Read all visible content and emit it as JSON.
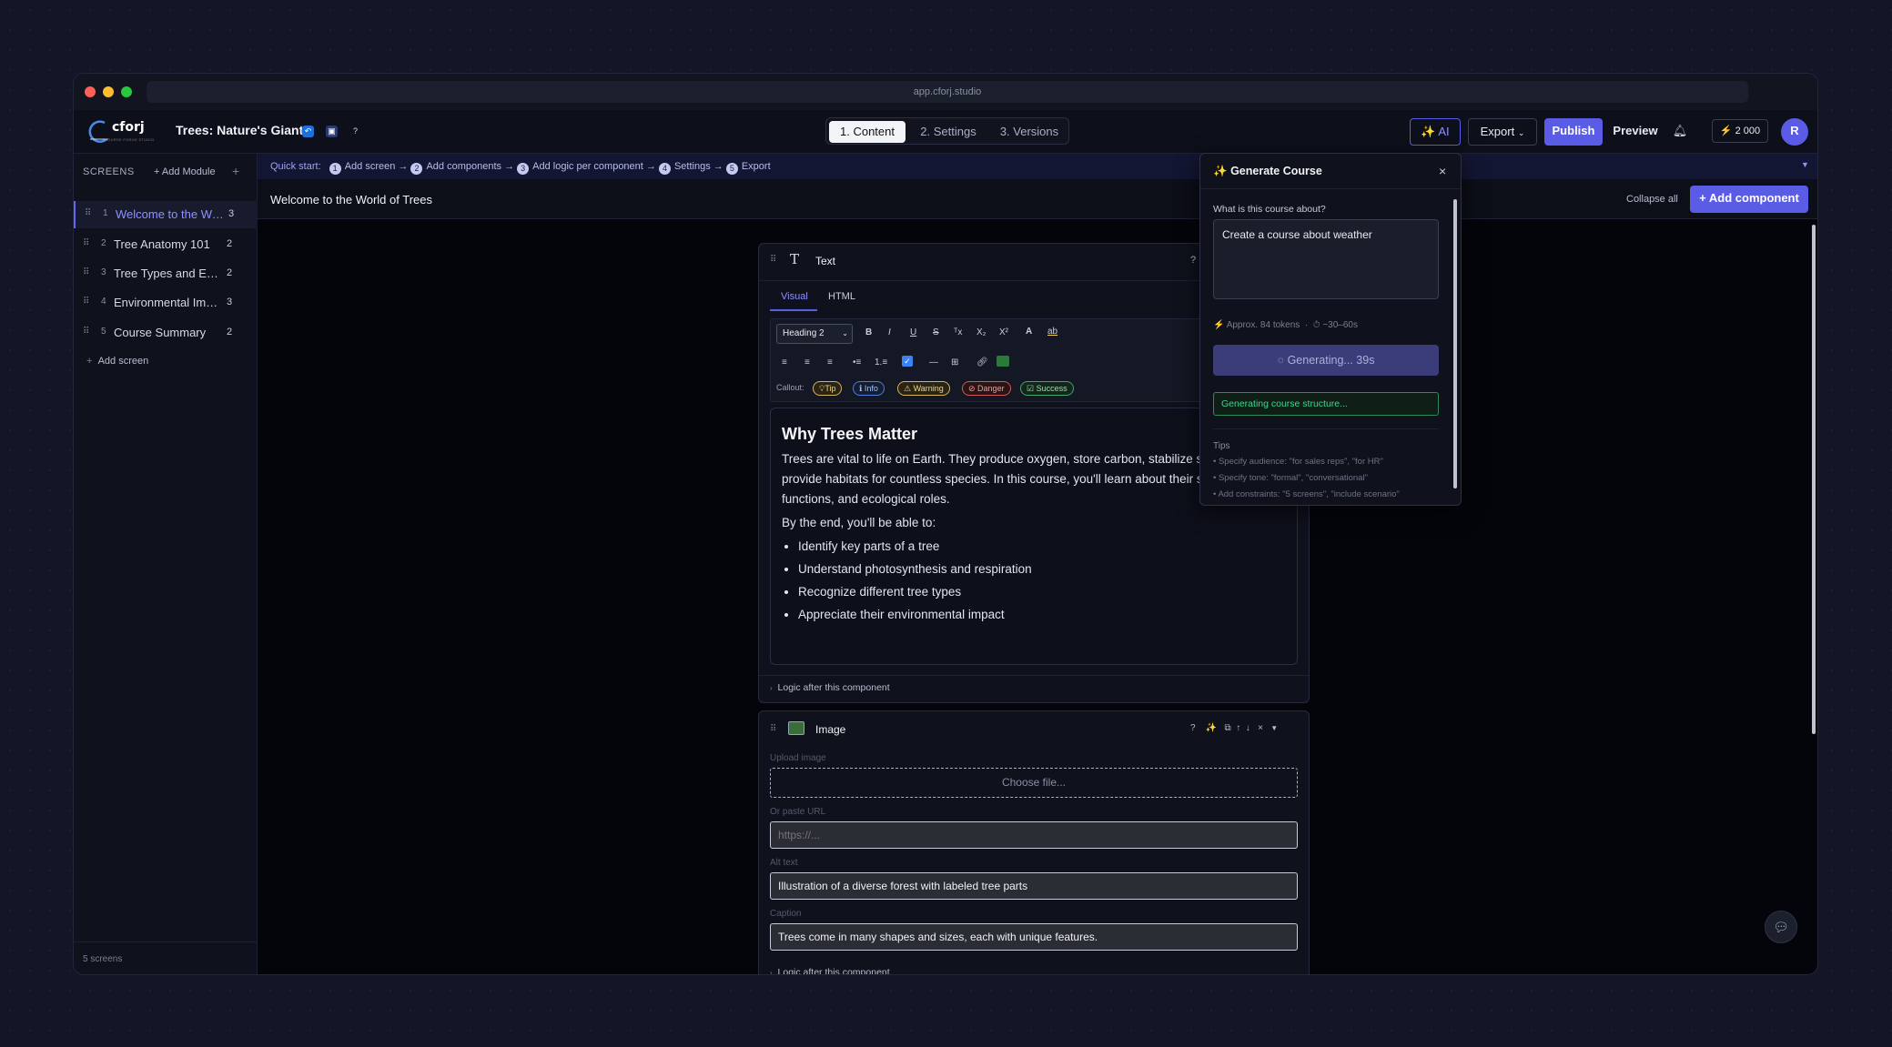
{
  "browser": {
    "url": "app.cforj.studio"
  },
  "app": {
    "logo_word": "cforj",
    "logo_tagline": "COURSE FORGE STUDIO",
    "project_title": "Trees: Nature's Giants",
    "help": "?"
  },
  "tabs": [
    {
      "label": "1. Content"
    },
    {
      "label": "2. Settings"
    },
    {
      "label": "3. Versions"
    }
  ],
  "header": {
    "ai_label": "AI",
    "export_label": "Export",
    "publish_label": "Publish",
    "preview_label": "Preview",
    "credits": "2 000",
    "avatar": "R"
  },
  "sidebar": {
    "heading": "SCREENS",
    "add_module": "+ Add Module",
    "add_icon": "+",
    "add_screen": "Add screen",
    "footer": "5 screens",
    "items": [
      {
        "num": "1",
        "label": "Welcome to the World of Trees",
        "count": "3"
      },
      {
        "num": "2",
        "label": "Tree Anatomy 101",
        "count": "2"
      },
      {
        "num": "3",
        "label": "Tree Types and Ecology",
        "count": "2"
      },
      {
        "num": "4",
        "label": "Environmental Impact",
        "count": "3"
      },
      {
        "num": "5",
        "label": "Course Summary",
        "count": "2"
      }
    ]
  },
  "quickstart": {
    "label": "Quick start:",
    "steps": [
      {
        "n": "1",
        "label": "Add screen"
      },
      {
        "n": "2",
        "label": "Add components"
      },
      {
        "n": "3",
        "label": "Add logic per component"
      },
      {
        "n": "4",
        "label": "Settings"
      },
      {
        "n": "5",
        "label": "Export"
      }
    ]
  },
  "screen": {
    "title": "Welcome to the World of Trees",
    "collapse_all": "Collapse all",
    "add_component": "Add component"
  },
  "text_component": {
    "title": "Text",
    "mode_tabs": [
      "Visual",
      "HTML"
    ],
    "heading_select": "Heading 2",
    "callout_label": "Callout:",
    "callouts": [
      "Tip",
      "Info",
      "Warning",
      "Danger",
      "Success"
    ],
    "content": {
      "heading": "Why Trees Matter",
      "para1_line1": "Trees are vital to life on Earth. They produce oxygen, store carbon, stabilize soil, and",
      "para1_line2": "provide habitats for countless species. In this course, you'll learn about their structure,",
      "para1_line3": "functions, and ecological roles.",
      "para2": "By the end, you'll be able to:",
      "bullets": [
        "Identify key parts of a tree",
        "Understand photosynthesis and respiration",
        "Recognize different tree types",
        "Appreciate their environmental impact"
      ]
    },
    "logic_label": "Logic after this component"
  },
  "image_component": {
    "title": "Image",
    "upload_label": "Upload image",
    "choose_file": "Choose file...",
    "url_label": "Or paste URL",
    "url_placeholder": "https://...",
    "alt_label": "Alt text",
    "alt_value": "Illustration of a diverse forest with labeled tree parts",
    "caption_label": "Caption",
    "caption_value": "Trees come in many shapes and sizes, each with unique features.",
    "logic_label": "Logic after this component"
  },
  "generate_panel": {
    "title": "Generate Course",
    "close": "×",
    "question": "What is this course about?",
    "prompt_value": "Create a course about weather",
    "tokens": "Approx. 84 tokens",
    "time": "~30–60s",
    "generating": "Generating... 39s",
    "status": "Generating course structure...",
    "tips_heading": "Tips",
    "tips": [
      "• Specify audience: \"for sales reps\", \"for HR\"",
      "• Specify tone: \"formal\", \"conversational\"",
      "• Add constraints: \"5 screens\", \"include scenario\""
    ]
  },
  "colors": {
    "accent": "#5b5ce6",
    "bg": "#0a0c16",
    "success": "#3dd68c"
  }
}
